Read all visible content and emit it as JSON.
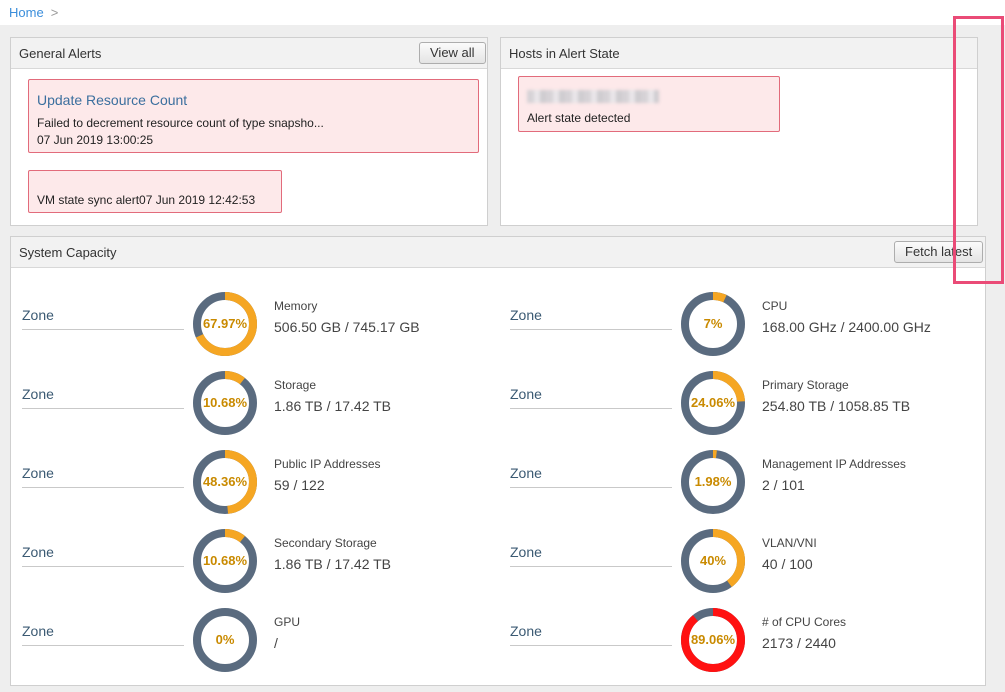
{
  "breadcrumb": {
    "home": "Home",
    "separator": ">"
  },
  "general_alerts": {
    "title": "General Alerts",
    "view_all_label": "View all",
    "alerts": [
      {
        "title": "Update Resource Count",
        "message": "Failed to decrement resource count of type snapsho...",
        "date": "07 Jun 2019 13:00:25"
      },
      {
        "message": "VM state sync alert07 Jun 2019 12:42:53"
      }
    ]
  },
  "hosts_alert": {
    "title": "Hosts in Alert State",
    "hosts": [
      {
        "message": "Alert state detected"
      }
    ]
  },
  "system_capacity": {
    "title": "System Capacity",
    "fetch_label": "Fetch latest",
    "colors": {
      "used": "#f5a623",
      "free": "#5a6b7f",
      "critical": "#ff1111",
      "percent_text": "#c98a00"
    },
    "metrics": [
      {
        "zone": "Zone",
        "name": "Memory",
        "percent_label": "67.97%",
        "percent": 67.97,
        "value": "506.50 GB / 745.17 GB"
      },
      {
        "zone": "Zone",
        "name": "CPU",
        "percent_label": "7%",
        "percent": 7,
        "value": "168.00 GHz / 2400.00 GHz"
      },
      {
        "zone": "Zone",
        "name": "Storage",
        "percent_label": "10.68%",
        "percent": 10.68,
        "value": "1.86 TB / 17.42 TB"
      },
      {
        "zone": "Zone",
        "name": "Primary Storage",
        "percent_label": "24.06%",
        "percent": 24.06,
        "value": "254.80 TB / 1058.85 TB"
      },
      {
        "zone": "Zone",
        "name": "Public IP Addresses",
        "percent_label": "48.36%",
        "percent": 48.36,
        "value": "59 / 122"
      },
      {
        "zone": "Zone",
        "name": "Management IP Addresses",
        "percent_label": "1.98%",
        "percent": 1.98,
        "value": "2 / 101"
      },
      {
        "zone": "Zone",
        "name": "Secondary Storage",
        "percent_label": "10.68%",
        "percent": 10.68,
        "value": "1.86 TB / 17.42 TB"
      },
      {
        "zone": "Zone",
        "name": "VLAN/VNI",
        "percent_label": "40%",
        "percent": 40,
        "value": "40 / 100"
      },
      {
        "zone": "Zone",
        "name": "GPU",
        "percent_label": "0%",
        "percent": 0,
        "value": "/"
      },
      {
        "zone": "Zone",
        "name": "# of CPU Cores",
        "percent_label": "89.06%",
        "percent": 89.06,
        "value": "2173 / 2440",
        "critical": true
      }
    ]
  }
}
